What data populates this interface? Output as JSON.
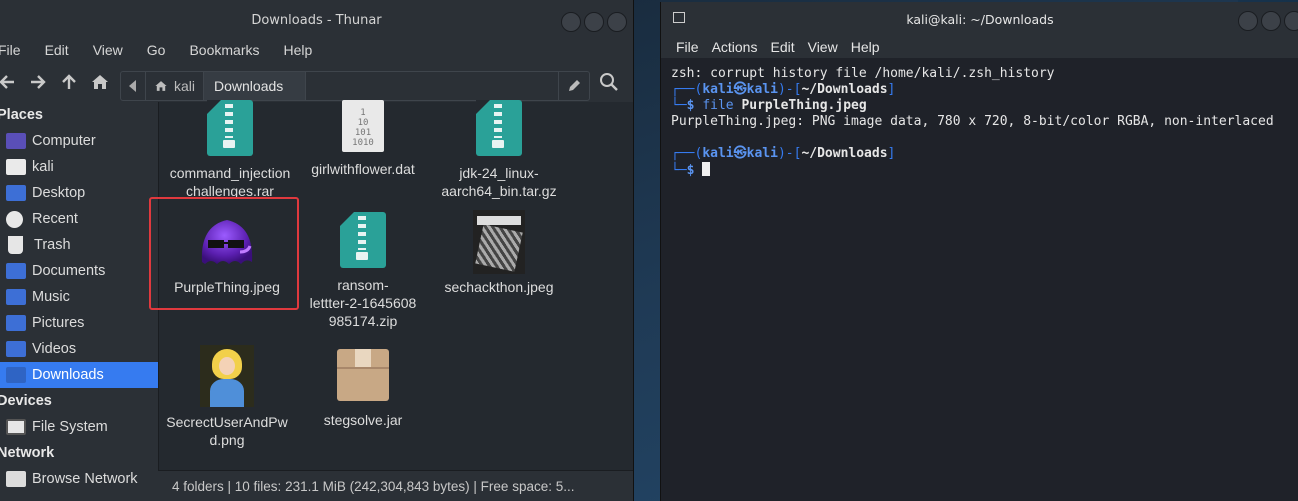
{
  "thunar": {
    "title": "Downloads - Thunar",
    "menu": [
      "File",
      "Edit",
      "View",
      "Go",
      "Bookmarks",
      "Help"
    ],
    "path": {
      "home_label": "kali",
      "current": "Downloads"
    },
    "sidebar": {
      "places_heading": "Places",
      "places": [
        {
          "label": "Computer",
          "icon": "computer-icon"
        },
        {
          "label": "kali",
          "icon": "home-folder-icon"
        },
        {
          "label": "Desktop",
          "icon": "desktop-folder-icon"
        },
        {
          "label": "Recent",
          "icon": "recent-icon"
        },
        {
          "label": "Trash",
          "icon": "trash-icon"
        },
        {
          "label": "Documents",
          "icon": "documents-folder-icon"
        },
        {
          "label": "Music",
          "icon": "music-folder-icon"
        },
        {
          "label": "Pictures",
          "icon": "pictures-folder-icon"
        },
        {
          "label": "Videos",
          "icon": "videos-folder-icon"
        },
        {
          "label": "Downloads",
          "icon": "downloads-folder-icon",
          "selected": true
        }
      ],
      "devices_heading": "Devices",
      "devices": [
        {
          "label": "File System",
          "icon": "drive-icon"
        }
      ],
      "network_heading": "Network",
      "network": [
        {
          "label": "Browse Network",
          "icon": "network-icon"
        }
      ]
    },
    "files": {
      "f1": "command_injection\nchallenges.rar",
      "f2": "girlwithflower.dat",
      "f3": "jdk-24_linux-\naarch64_bin.tar.gz",
      "f4": "PurpleThing.jpeg",
      "f5": "ransom-\nlettter-2-1645608\n985174.zip",
      "f6": "sechackthon.jpeg",
      "f7": "SecrectUserAndPw\nd.png",
      "f8": "stegsolve.jar"
    },
    "dat_glyph": "1\n10\n101\n1010",
    "statusbar": "4 folders  |  10 files: 231.1 MiB (242,304,843 bytes)  |  Free space: 5..."
  },
  "terminal": {
    "title": "kali@kali: ~/Downloads",
    "menu": [
      "File",
      "Actions",
      "Edit",
      "View",
      "Help"
    ],
    "lines": {
      "l1": "zsh: corrupt history file /home/kali/.zsh_history",
      "prompt_user": "kali",
      "prompt_at": "㉿",
      "prompt_host": "kali",
      "prompt_dir": "~/Downloads",
      "cmd": "file",
      "cmd_arg": "PurpleThing.jpeg",
      "output": "PurpleThing.jpeg: PNG image data, 780 x 720, 8-bit/color RGBA, non-interlaced"
    }
  },
  "colors": {
    "accent": "#367bf0",
    "highlight_box": "#e0393e",
    "zip_teal": "#2aa198"
  }
}
